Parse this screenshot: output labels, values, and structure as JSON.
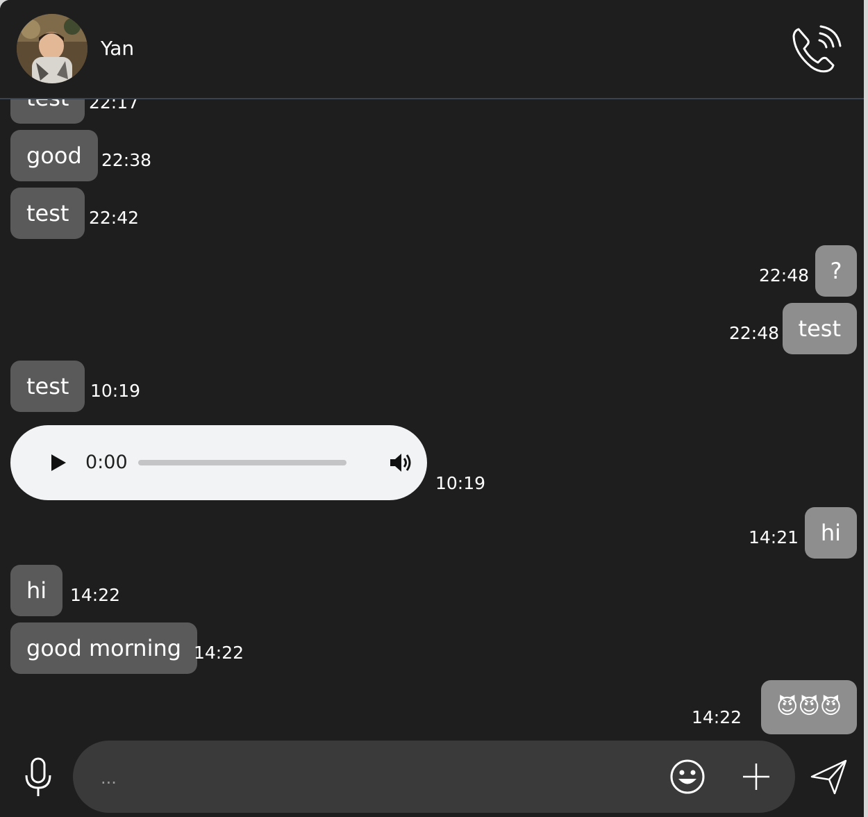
{
  "header": {
    "contact_name": "Yan",
    "call_icon": "phone-call-icon"
  },
  "messages": [
    {
      "direction": "in",
      "text": "test",
      "time": "22:17"
    },
    {
      "direction": "in",
      "text": "good",
      "time": "22:38"
    },
    {
      "direction": "in",
      "text": "test",
      "time": "22:42"
    },
    {
      "direction": "out",
      "text": "?",
      "time": "22:48"
    },
    {
      "direction": "out",
      "text": "test",
      "time": "22:48"
    },
    {
      "direction": "in",
      "text": "test",
      "time": "10:19"
    },
    {
      "direction": "out",
      "text": "hi",
      "time": "14:21"
    },
    {
      "direction": "in",
      "text": "hi",
      "time": "14:22"
    },
    {
      "direction": "in",
      "text": "good morning",
      "time": "14:22"
    },
    {
      "direction": "out",
      "text": "😈😈😈",
      "time": "14:22"
    }
  ],
  "audio_message": {
    "current_time": "0:00",
    "progress": 0,
    "time": "10:19",
    "play_icon": "play-icon",
    "volume_icon": "volume-icon"
  },
  "composer": {
    "placeholder": "...",
    "value": "",
    "mic_icon": "microphone-icon",
    "emoji_icon": "emoji-icon",
    "attach_icon": "plus-icon",
    "send_icon": "send-icon"
  },
  "colors": {
    "background": "#1e1e1f",
    "incoming_bubble": "#5a5a5b",
    "outgoing_bubble": "#8e8e8f",
    "audio_player": "#f1f3f4",
    "composer_pill": "#3a3a3b",
    "header_divider": "#3a4450"
  }
}
